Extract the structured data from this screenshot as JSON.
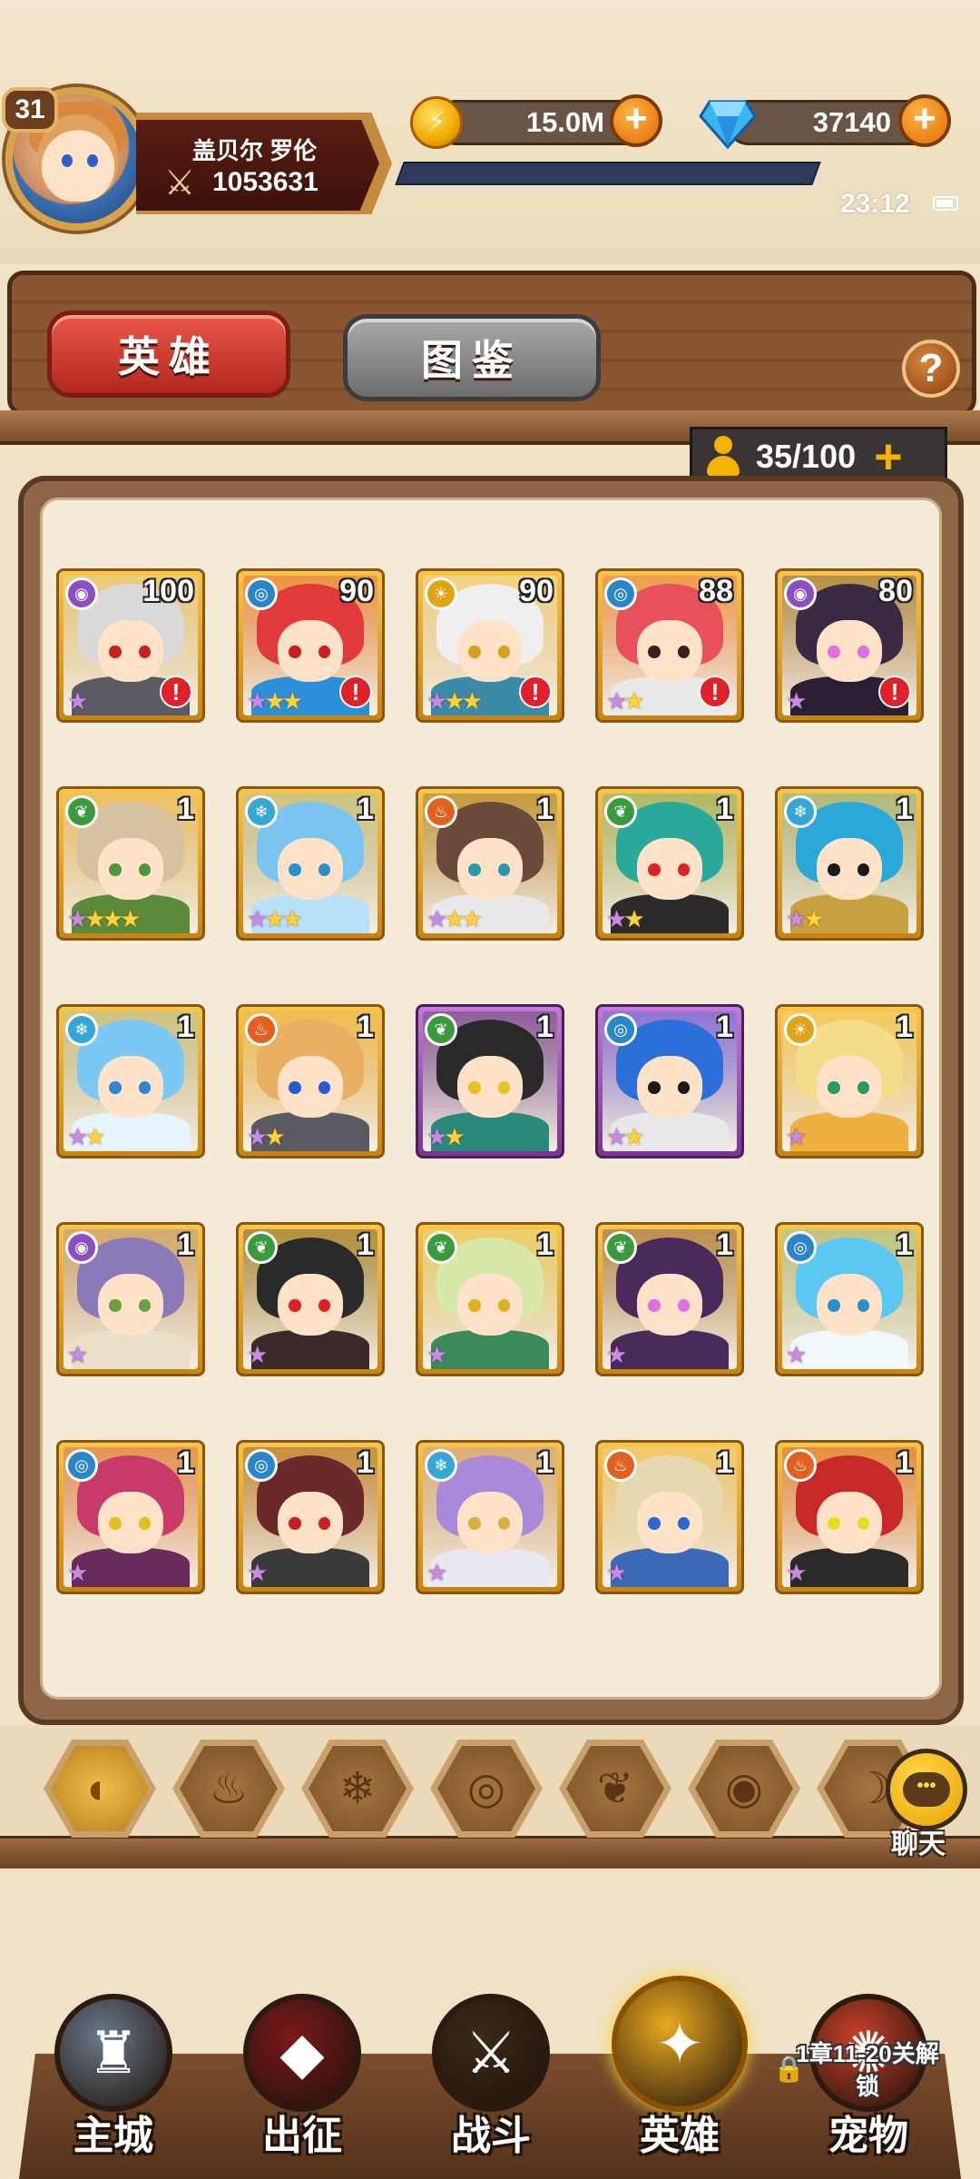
{
  "player": {
    "level": "31",
    "name": "盖贝尔 罗伦",
    "power": "1053631"
  },
  "resources": {
    "gold": "15.0M",
    "gems": "37140"
  },
  "status": {
    "time": "23:12"
  },
  "tabs": {
    "hero": "英雄",
    "codex": "图鉴",
    "help": "?"
  },
  "capacity": "35/100",
  "heroes": [
    {
      "element": "dark",
      "level": "100",
      "stars": "1p",
      "alert": true,
      "hair": "#d9d9d9",
      "body": "#5b5b63",
      "eye": "#c82020"
    },
    {
      "element": "water",
      "level": "90",
      "stars": "1p2g",
      "alert": true,
      "hair": "#e23a3a",
      "body": "#2c8fd8",
      "eye": "#c82020"
    },
    {
      "element": "light",
      "level": "90",
      "stars": "1p2g",
      "alert": true,
      "hair": "#efefef",
      "body": "#3a8aa8",
      "eye": "#d8a020"
    },
    {
      "element": "water",
      "level": "88",
      "stars": "1p1g",
      "alert": true,
      "hair": "#e8505a",
      "body": "#e9e9e9",
      "eye": "#3a2020"
    },
    {
      "element": "dark",
      "level": "80",
      "stars": "1p",
      "alert": true,
      "hair": "#3a2a44",
      "body": "#2a1f33",
      "eye": "#e070e0"
    },
    {
      "element": "wind",
      "level": "1",
      "stars": "1p3g",
      "alert": false,
      "hair": "#d6c2a0",
      "body": "#5a8a3a",
      "eye": "#4a9a3a"
    },
    {
      "element": "ice",
      "level": "1",
      "stars": "1p2g",
      "alert": false,
      "hair": "#7cc4f0",
      "body": "#b8e0f8",
      "eye": "#2a90c8"
    },
    {
      "element": "fire",
      "level": "1",
      "stars": "1p2g",
      "alert": false,
      "hair": "#6a4a3a",
      "body": "#e9e9e9",
      "eye": "#2a9ab0"
    },
    {
      "element": "wind",
      "level": "1",
      "stars": "1p1g",
      "alert": false,
      "hair": "#2aa89a",
      "body": "#2a2a2a",
      "eye": "#e02020"
    },
    {
      "element": "ice",
      "level": "1",
      "stars": "1p1g",
      "alert": false,
      "hair": "#2aa8d8",
      "body": "#c8a040",
      "eye": "#1a1a1a"
    },
    {
      "element": "ice",
      "level": "1",
      "stars": "1p1g",
      "alert": false,
      "hair": "#7cc8f4",
      "body": "#e8f4fc",
      "eye": "#2a8ad0"
    },
    {
      "element": "fire",
      "level": "1",
      "stars": "1p1g",
      "alert": false,
      "hair": "#e8b060",
      "body": "#5a5a62",
      "eye": "#2a5ad0"
    },
    {
      "element": "wind",
      "level": "1",
      "stars": "1p1g",
      "alert": false,
      "hair": "#2a2a2a",
      "body": "#2a8a7a",
      "eye": "#e8c020",
      "frame": "purple"
    },
    {
      "element": "water",
      "level": "1",
      "stars": "1p1g",
      "alert": false,
      "hair": "#2a70d8",
      "body": "#e8e8e8",
      "eye": "#1a1a1a",
      "frame": "purple"
    },
    {
      "element": "light",
      "level": "1",
      "stars": "1p",
      "alert": false,
      "hair": "#f4dc8a",
      "body": "#f0b040",
      "eye": "#2a9a6a"
    },
    {
      "element": "dark",
      "level": "1",
      "stars": "1p",
      "alert": false,
      "hair": "#8a7ab8",
      "body": "#e8e0c8",
      "eye": "#6aa040"
    },
    {
      "element": "wind",
      "level": "1",
      "stars": "1p",
      "alert": false,
      "hair": "#2a2a2a",
      "body": "#3a2a2a",
      "eye": "#e02020"
    },
    {
      "element": "wind",
      "level": "1",
      "stars": "1p",
      "alert": false,
      "hair": "#d8e8a8",
      "body": "#3a8a5a",
      "eye": "#e0b020"
    },
    {
      "element": "wind",
      "level": "1",
      "stars": "1p",
      "alert": false,
      "hair": "#4a2a5a",
      "body": "#4a2a5a",
      "eye": "#e070e0"
    },
    {
      "element": "water",
      "level": "1",
      "stars": "1p",
      "alert": false,
      "hair": "#5ac8f0",
      "body": "#f0f8fc",
      "eye": "#2a90c8"
    },
    {
      "element": "water",
      "level": "1",
      "stars": "1p",
      "alert": false,
      "hair": "#c83a6a",
      "body": "#6a2a5a",
      "eye": "#e0c020"
    },
    {
      "element": "water",
      "level": "1",
      "stars": "1p",
      "alert": false,
      "hair": "#6a2a2a",
      "body": "#3a3a3a",
      "eye": "#c82020"
    },
    {
      "element": "ice",
      "level": "1",
      "stars": "1p",
      "alert": false,
      "hair": "#a88ad8",
      "body": "#e8e8f0",
      "eye": "#d8b040"
    },
    {
      "element": "fire",
      "level": "1",
      "stars": "1p",
      "alert": false,
      "hair": "#e8d8b0",
      "body": "#3a6ab8",
      "eye": "#2a6ad0"
    },
    {
      "element": "fire",
      "level": "1",
      "stars": "1p",
      "alert": false,
      "hair": "#c82a2a",
      "body": "#2a2a2a",
      "eye": "#e0e020"
    }
  ],
  "element_colors": {
    "dark": "#8b4fc2",
    "water": "#2a86c8",
    "light": "#e0a416",
    "wind": "#3a9a3e",
    "ice": "#33a7d6",
    "fire": "#e2611e"
  },
  "element_glyphs": {
    "dark": "◉",
    "water": "◎",
    "light": "☀",
    "wind": "❦",
    "ice": "❄",
    "fire": "♨"
  },
  "filters": [
    {
      "name": "all-filter-icon",
      "glyph": "◐"
    },
    {
      "name": "fire-filter-icon",
      "glyph": "♨"
    },
    {
      "name": "ice-filter-icon",
      "glyph": "❄"
    },
    {
      "name": "water-filter-icon",
      "glyph": "◎"
    },
    {
      "name": "wind-filter-icon",
      "glyph": "❦"
    },
    {
      "name": "dark-filter-icon",
      "glyph": "◉"
    },
    {
      "name": "light-filter-icon",
      "glyph": "☽"
    }
  ],
  "chat": {
    "label": "聊天"
  },
  "nav": [
    {
      "label": "主城",
      "color": "#6a7a8a",
      "icon": "castle-icon",
      "glyph": "♜"
    },
    {
      "label": "出征",
      "color": "#7a1a1a",
      "icon": "expedition-icon",
      "glyph": "◆"
    },
    {
      "label": "战斗",
      "color": "#3a2a1a",
      "icon": "battle-icon",
      "glyph": "⚔"
    },
    {
      "label": "英雄",
      "color": "#e8a820",
      "icon": "hero-icon",
      "glyph": "✦"
    },
    {
      "label": "宠物",
      "color": "#c8402a",
      "icon": "pet-icon",
      "glyph": "✺"
    }
  ],
  "nav_lock": "1章11-20关解锁"
}
